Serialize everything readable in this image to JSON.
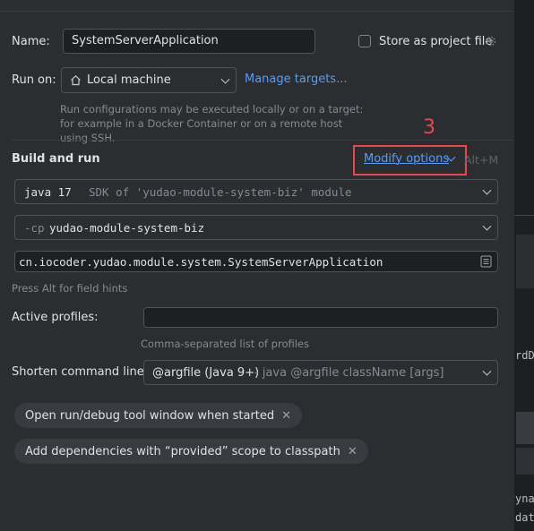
{
  "form": {
    "name_label": "Name:",
    "name_value": "SystemServerApplication",
    "store_label": "Store as project file",
    "run_on_label": "Run on:",
    "run_on_value": "Local machine",
    "manage_targets": "Manage targets...",
    "run_on_hint": "Run configurations may be executed locally or on a target: for example in a Docker Container or on a remote host using SSH."
  },
  "build": {
    "section_title": "Build and run",
    "modify_options": "Modify options",
    "modify_shortcut": "Alt+M",
    "annotation_number": "3",
    "jdk_version": "java 17",
    "jdk_desc": "SDK of 'yudao-module-system-biz' module",
    "cp_flag": "-cp",
    "cp_value": "yudao-module-system-biz",
    "main_class": "cn.iocoder.yudao.module.system.SystemServerApplication",
    "field_hint": "Press Alt for field hints"
  },
  "profiles": {
    "label": "Active profiles:",
    "value": "",
    "hint": "Comma-separated list of profiles"
  },
  "shorten": {
    "label": "Shorten command line:",
    "value": "@argfile (Java 9+)",
    "desc": "- java @argfile className [args]"
  },
  "tags": [
    {
      "label": "Open run/debug tool window when started"
    },
    {
      "label": "Add dependencies with “provided” scope to classpath"
    }
  ],
  "right_panel": {
    "snippet1": "rdD",
    "snippet2": "yna",
    "snippet3": "dat"
  },
  "colors": {
    "background": "#2b2d30",
    "link": "#589df6",
    "annotation_red": "#e5484d"
  }
}
